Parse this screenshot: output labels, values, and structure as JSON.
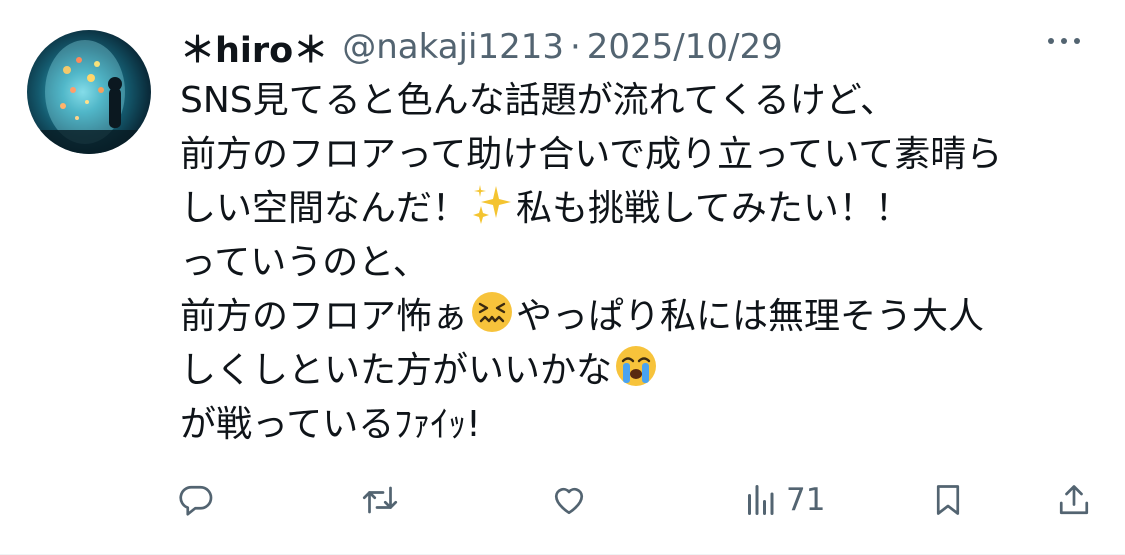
{
  "post": {
    "author_name": "＊hiro＊",
    "handle": "@nakaji1213",
    "separator": "·",
    "date": "2025/10/29",
    "lines": [
      {
        "before": "SNS見てると色んな話題が流れてくるけど、",
        "emoji": null,
        "after": ""
      },
      {
        "before": "前方のフロアって助け合いで成り立っていて素晴ら",
        "emoji": null,
        "after": ""
      },
      {
        "before": "しい空間なんだ！",
        "emoji": "sparkles-emoji",
        "after": "私も挑戦してみたい！！"
      },
      {
        "before": "っていうのと、",
        "emoji": null,
        "after": ""
      },
      {
        "before": "前方のフロア怖ぁ",
        "emoji": "confounded-face-emoji",
        "after": "やっぱり私には無理そう大人"
      },
      {
        "before": "しくしといた方がいいかな",
        "emoji": "crying-face-emoji",
        "after": ""
      },
      {
        "before": "が戦っているﾌｧｲｯ!",
        "emoji": null,
        "after": ""
      }
    ]
  },
  "actions": {
    "reply": {
      "icon": "reply-icon",
      "count": ""
    },
    "repost": {
      "icon": "repost-icon",
      "count": ""
    },
    "like": {
      "icon": "heart-icon",
      "count": ""
    },
    "views": {
      "icon": "views-icon",
      "count": "71"
    },
    "bookmark": {
      "icon": "bookmark-icon",
      "count": ""
    },
    "share": {
      "icon": "share-icon",
      "count": ""
    }
  },
  "colors": {
    "text": "#0f1419",
    "secondary": "#536471",
    "background": "#ffffff"
  }
}
